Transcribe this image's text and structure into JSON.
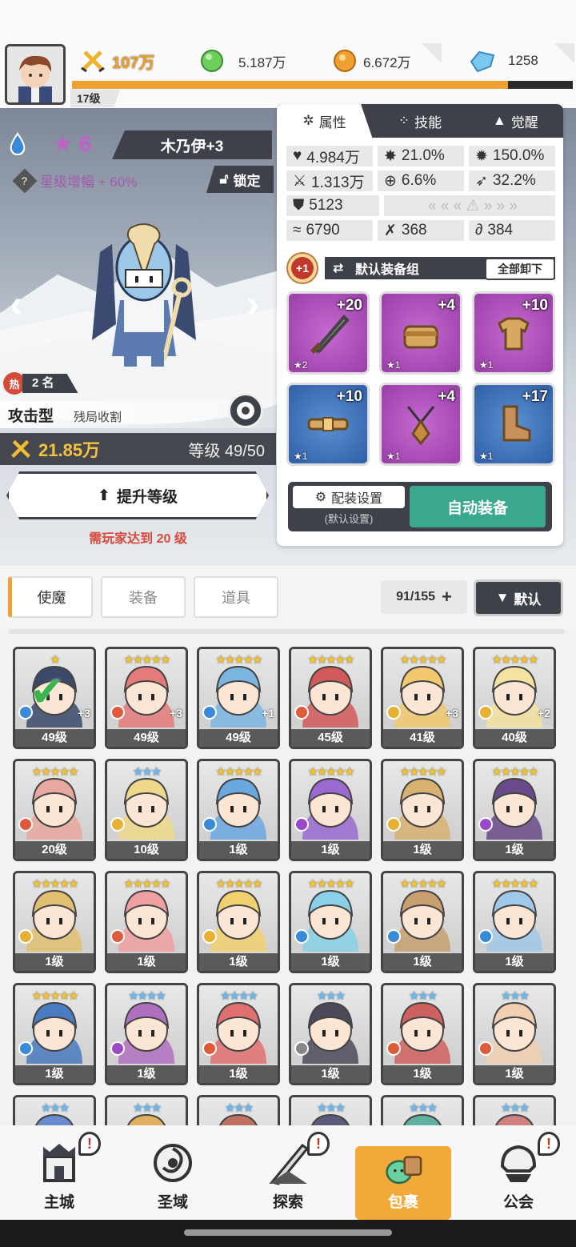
{
  "player": {
    "level": "17级"
  },
  "resources": {
    "power": "107万",
    "green": "5.187万",
    "gold": "6.672万",
    "gem": "1258"
  },
  "hero": {
    "name": "木乃伊+3",
    "star": "6",
    "star_bonus": "星级增幅 + 60%",
    "lock": "锁定",
    "hot_label": "热",
    "hot_rank": "2 名",
    "type": "攻击型",
    "type_desc": "残局收割",
    "power": "21.85万",
    "level": "等级 49/50",
    "upgrade": "提升等级",
    "requirement": "需玩家达到 20 级"
  },
  "attr_panel": {
    "tabs": [
      "属性",
      "技能",
      "觉醒"
    ],
    "stats": {
      "hp": "4.984万",
      "crit": "21.0%",
      "crit_dmg": "150.0%",
      "atk": "1.313万",
      "acc": "6.6%",
      "dodge": "32.2%",
      "def": "5123",
      "speed": "6790",
      "s1": "368",
      "s2": "384"
    },
    "equip_badge": "+1",
    "equip_group": "默认装备组",
    "unequip_all": "全部卸下",
    "slots": [
      {
        "plus": "+20",
        "star": "★2",
        "rarity": "purple",
        "item": "sword"
      },
      {
        "plus": "+4",
        "star": "★1",
        "rarity": "purple",
        "item": "helmet"
      },
      {
        "plus": "+10",
        "star": "★1",
        "rarity": "purple",
        "item": "armor"
      },
      {
        "plus": "+10",
        "star": "★1",
        "rarity": "blue",
        "item": "belt"
      },
      {
        "plus": "+4",
        "star": "★1",
        "rarity": "purple",
        "item": "necklace"
      },
      {
        "plus": "+17",
        "star": "★1",
        "rarity": "blue",
        "item": "boots"
      }
    ],
    "config": "配装设置",
    "config_sub": "(默认设置)",
    "auto_equip": "自动装备"
  },
  "category": {
    "tabs": [
      "使魔",
      "装备",
      "道具"
    ],
    "count": "91/155",
    "sort": "默认"
  },
  "roster": [
    {
      "stars": "★",
      "level": "49级",
      "plus": "+3",
      "elem": "water",
      "color": "#3b4a6a",
      "selected": true
    },
    {
      "stars": "★★★★★",
      "level": "49级",
      "plus": "+3",
      "elem": "fire",
      "color": "#e57a7a"
    },
    {
      "stars": "★★★★★",
      "level": "49级",
      "plus": "+1",
      "elem": "water",
      "color": "#7ab6e0"
    },
    {
      "stars": "★★★★★",
      "level": "45级",
      "plus": "",
      "elem": "fire",
      "color": "#d25a5a"
    },
    {
      "stars": "★★★★★",
      "level": "41级",
      "plus": "+3",
      "elem": "light",
      "color": "#f2c870"
    },
    {
      "stars": "★★★★★",
      "level": "40级",
      "plus": "+2",
      "elem": "light",
      "color": "#f5e2a0"
    },
    {
      "stars": "★★★★★",
      "level": "20级",
      "plus": "",
      "elem": "fire",
      "color": "#e8a8a0"
    },
    {
      "stars": "★★★",
      "level": "10级",
      "plus": "",
      "elem": "light",
      "color": "#f0d88a",
      "blue": true
    },
    {
      "stars": "★★★★★",
      "level": "1级",
      "plus": "",
      "elem": "water",
      "color": "#6aa8e0"
    },
    {
      "stars": "★★★★★",
      "level": "1级",
      "plus": "",
      "elem": "dark",
      "color": "#9a6ad0"
    },
    {
      "stars": "★★★★★",
      "level": "1级",
      "plus": "",
      "elem": "light",
      "color": "#d8b070"
    },
    {
      "stars": "★★★★★",
      "level": "1级",
      "plus": "",
      "elem": "dark",
      "color": "#6a4a8a"
    },
    {
      "stars": "★★★★★",
      "level": "1级",
      "plus": "",
      "elem": "light",
      "color": "#e0c070"
    },
    {
      "stars": "★★★★★",
      "level": "1级",
      "plus": "",
      "elem": "fire",
      "color": "#f0a0a0"
    },
    {
      "stars": "★★★★★",
      "level": "1级",
      "plus": "",
      "elem": "light",
      "color": "#f2d070"
    },
    {
      "stars": "★★★★★",
      "level": "1级",
      "plus": "",
      "elem": "water",
      "color": "#8ad0e8"
    },
    {
      "stars": "★★★★★",
      "level": "1级",
      "plus": "",
      "elem": "water",
      "color": "#c8a070"
    },
    {
      "stars": "★★★★★",
      "level": "1级",
      "plus": "",
      "elem": "water",
      "color": "#a0c8e8"
    },
    {
      "stars": "★★★★★",
      "level": "1级",
      "plus": "",
      "elem": "water",
      "color": "#4a7ac0"
    },
    {
      "stars": "★★★★",
      "level": "1级",
      "plus": "",
      "elem": "dark",
      "color": "#b070c0",
      "blue": true
    },
    {
      "stars": "★★★★",
      "level": "1级",
      "plus": "",
      "elem": "fire",
      "color": "#e07070",
      "blue": true
    },
    {
      "stars": "★★★",
      "level": "1级",
      "plus": "",
      "elem": "wind",
      "color": "#4a4a5a",
      "blue": true
    },
    {
      "stars": "★★★",
      "level": "1级",
      "plus": "",
      "elem": "fire",
      "color": "#d06060",
      "blue": true
    },
    {
      "stars": "★★★",
      "level": "1级",
      "plus": "",
      "elem": "fire",
      "color": "#f0d0b0",
      "blue": true
    },
    {
      "stars": "★★★",
      "level": "",
      "plus": "",
      "elem": "water",
      "color": "#6a8ad0",
      "blue": true
    },
    {
      "stars": "★★★",
      "level": "",
      "plus": "",
      "elem": "light",
      "color": "#e0b060",
      "blue": true
    },
    {
      "stars": "★★★",
      "level": "",
      "plus": "",
      "elem": "fire",
      "color": "#c07060",
      "blue": true
    },
    {
      "stars": "★★★",
      "level": "",
      "plus": "",
      "elem": "dark",
      "color": "#5a5a7a",
      "blue": true
    },
    {
      "stars": "★★★",
      "level": "",
      "plus": "",
      "elem": "water",
      "color": "#60b0a0",
      "blue": true
    },
    {
      "stars": "★★★",
      "level": "",
      "plus": "",
      "elem": "fire",
      "color": "#d08080",
      "blue": true
    }
  ],
  "nav": [
    {
      "label": "主城",
      "badge": "!"
    },
    {
      "label": "圣域",
      "badge": ""
    },
    {
      "label": "探索",
      "badge": "!"
    },
    {
      "label": "包裹",
      "badge": ""
    },
    {
      "label": "公会",
      "badge": "!"
    }
  ],
  "colors": {
    "accent": "#f3a83a",
    "dark": "#3e4149",
    "green": "#3aa88c",
    "fire": "#e05a3a",
    "water": "#3a8ad8",
    "light": "#e8b030",
    "dark_elem": "#9a4ac8",
    "wind": "#888888"
  }
}
